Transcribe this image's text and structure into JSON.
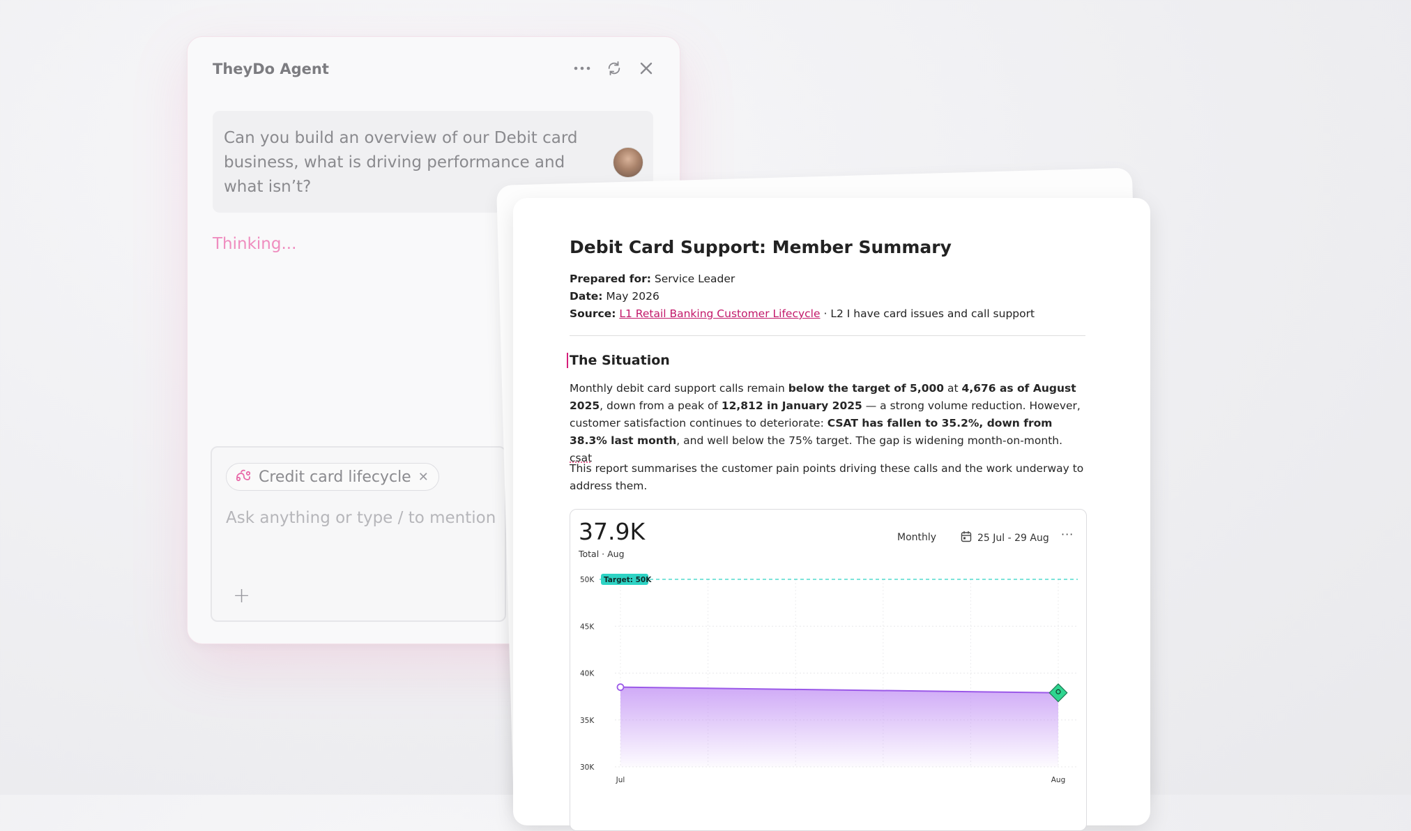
{
  "agent": {
    "title": "TheyDo Agent",
    "message": "Can you build an overview of our Debit card business, what is driving performance and what isn’t?",
    "status": "Thinking...",
    "chip_label": "Credit card lifecycle",
    "placeholder": "Ask anything or type / to mention",
    "icons": [
      "more-icon",
      "refresh-icon",
      "close-icon",
      "lifecycle-icon",
      "plus-icon"
    ]
  },
  "doc": {
    "title": "Debit Card Support: Member Summary",
    "prepared_label": "Prepared for:",
    "prepared_value": "Service Leader",
    "date_label": "Date:",
    "date_value": "May 2026",
    "source_label": "Source:",
    "source_link": "L1 Retail Banking Customer Lifecycle",
    "source_rest": "· L2 I have card issues and call support",
    "section_title": "The Situation",
    "p1": {
      "t1": "Monthly debit card support calls remain ",
      "b1": "below the target of 5,000",
      "t2": " at ",
      "b2": "4,676 as of August 2025",
      "t3": ", down from a peak of ",
      "b3": "12,812 in January 2025",
      "t4": " — a strong volume reduction. However, customer satisfaction continues to deteriorate: ",
      "b4": "CSAT has fallen to 35.2%, down from 38.3% last month",
      "t5": ", and well below the 75% target. The gap is widening month-on-month. ",
      "t6": "csat"
    },
    "p2": "This report summarises the customer pain points driving these calls and the work underway to address them."
  },
  "chart_card": {
    "value": "37.9K",
    "sublabel": "Total · Aug",
    "period": "Monthly",
    "date_range": "25 Jul - 29 Aug",
    "more": "···"
  },
  "colors": {
    "accent_pink": "#ef8dbf",
    "link": "#c2186a",
    "line": "#9b59e8",
    "target": "#2ed3c4"
  },
  "chart_data": {
    "type": "area",
    "x": [
      "Jul",
      "Aug"
    ],
    "values": [
      38500,
      37900
    ],
    "ylim": [
      30000,
      50000
    ],
    "yticks": [
      "50K",
      "45K",
      "40K",
      "35K",
      "30K"
    ],
    "target": {
      "value": 50000,
      "label": "Target: 50K"
    },
    "grid": true
  }
}
